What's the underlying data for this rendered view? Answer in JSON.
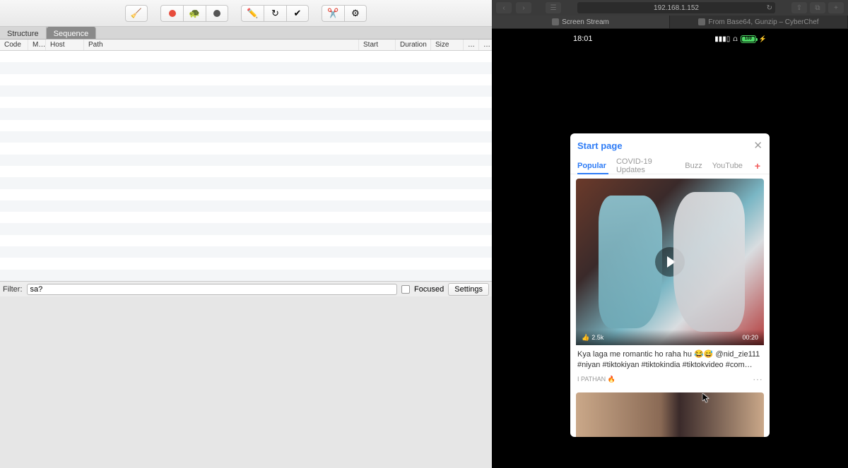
{
  "left": {
    "tabs": {
      "structure": "Structure",
      "sequence": "Sequence"
    },
    "columns": {
      "code": "Code",
      "method": "M…",
      "host": "Host",
      "path": "Path",
      "start": "Start",
      "duration": "Duration",
      "size": "Size",
      "more1": "…",
      "more2": "…"
    },
    "filter": {
      "label": "Filter:",
      "value": "sa?",
      "focused_label": "Focused",
      "settings": "Settings"
    }
  },
  "safari": {
    "url": "192.168.1.152",
    "tabs": {
      "screen": "Screen Stream",
      "cyberchef": "From Base64, Gunzip – CyberChef"
    }
  },
  "phone": {
    "time": "18:01",
    "battery": "100",
    "card_title": "Start page",
    "topics": {
      "popular": "Popular",
      "covid": "COVID-19 Updates",
      "buzz": "Buzz",
      "youtube": "YouTube"
    },
    "video1": {
      "likes": "2.5k",
      "duration": "00:20",
      "caption": "Kya laga me romantic ho raha hu 😂😅 @nid_zie111 #niyan #tiktokiyan #tiktokindia #tiktokvideo #com…",
      "author": "I PATHAN 🔥"
    }
  }
}
